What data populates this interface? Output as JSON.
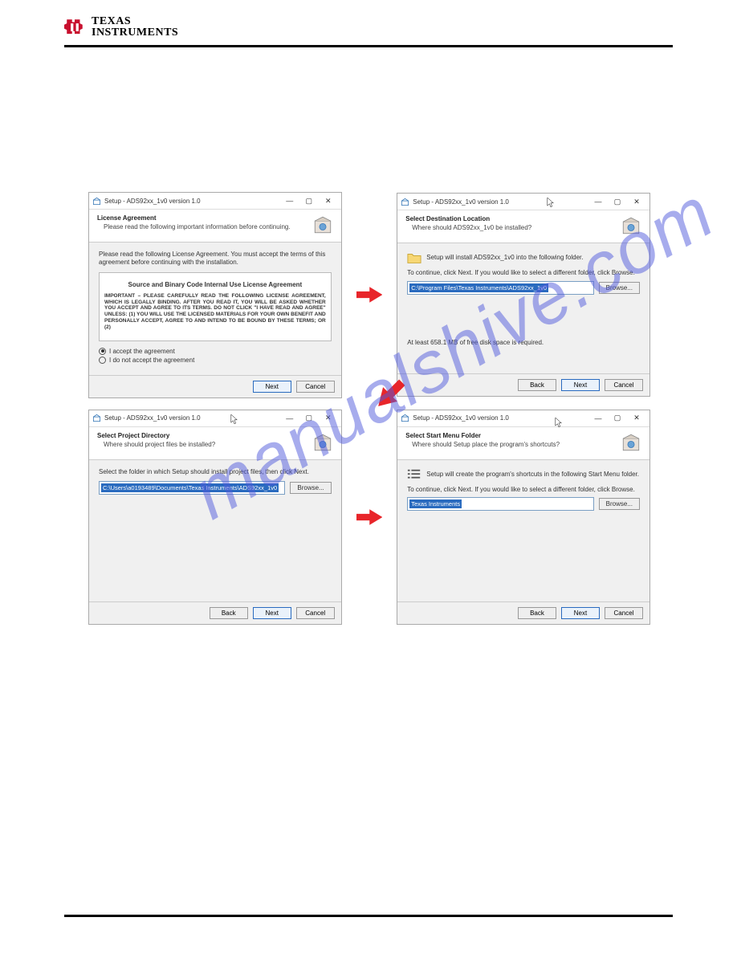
{
  "brand": {
    "line1": "TEXAS",
    "line2": "INSTRUMENTS"
  },
  "watermark": "manualshive.com",
  "dlg1": {
    "title": "Setup - ADS92xx_1v0 version 1.0",
    "heading": "License Agreement",
    "sub": "Please read the following important information before continuing.",
    "instr": "Please read the following License Agreement. You must accept the terms of this agreement before continuing with the installation.",
    "lic_title": "Source and Binary Code Internal Use License Agreement",
    "lic_body": "IMPORTANT – PLEASE CAREFULLY READ THE FOLLOWING LICENSE AGREEMENT, WHICH IS LEGALLY BINDING.  AFTER YOU READ IT, YOU WILL BE ASKED WHETHER YOU ACCEPT AND AGREE TO ITS TERMS.  DO NOT CLICK  \"I HAVE READ AND AGREE\" UNLESS: (1) YOU WILL USE THE LICENSED MATERIALS FOR YOUR OWN BENEFIT AND PERSONALLY ACCEPT, AGREE TO AND INTEND TO BE BOUND BY THESE TERMS; OR (2)",
    "radio_accept": "I accept the agreement",
    "radio_decline": "I do not accept the agreement",
    "next": "Next",
    "cancel": "Cancel"
  },
  "dlg2": {
    "title": "Setup - ADS92xx_1v0 version 1.0",
    "heading": "Select Destination Location",
    "sub": "Where should ADS92xx_1v0 be installed?",
    "info": "Setup will install ADS92xx_1v0 into the following folder.",
    "cont": "To continue, click Next. If you would like to select a different folder, click Browse.",
    "path": "C:\\Program Files\\Texas Instruments\\ADS92xx_1v0",
    "browse": "Browse...",
    "disk": "At least 658.1 MB of free disk space is required.",
    "back": "Back",
    "next": "Next",
    "cancel": "Cancel"
  },
  "dlg3": {
    "title": "Setup - ADS92xx_1v0 version 1.0",
    "heading": "Select Project Directory",
    "sub": "Where should project files be installed?",
    "instr": "Select the folder in which Setup should install project files, then click Next.",
    "path": "C:\\Users\\a0193489\\Documents\\Texas Instruments\\ADS92xx_1v0",
    "browse": "Browse...",
    "back": "Back",
    "next": "Next",
    "cancel": "Cancel"
  },
  "dlg4": {
    "title": "Setup - ADS92xx_1v0 version 1.0",
    "heading": "Select Start Menu Folder",
    "sub": "Where should Setup place the program's shortcuts?",
    "info": "Setup will create the program's shortcuts in the following Start Menu folder.",
    "cont": "To continue, click Next. If you would like to select a different folder, click Browse.",
    "path": "Texas Instruments",
    "browse": "Browse...",
    "back": "Back",
    "next": "Next",
    "cancel": "Cancel"
  }
}
